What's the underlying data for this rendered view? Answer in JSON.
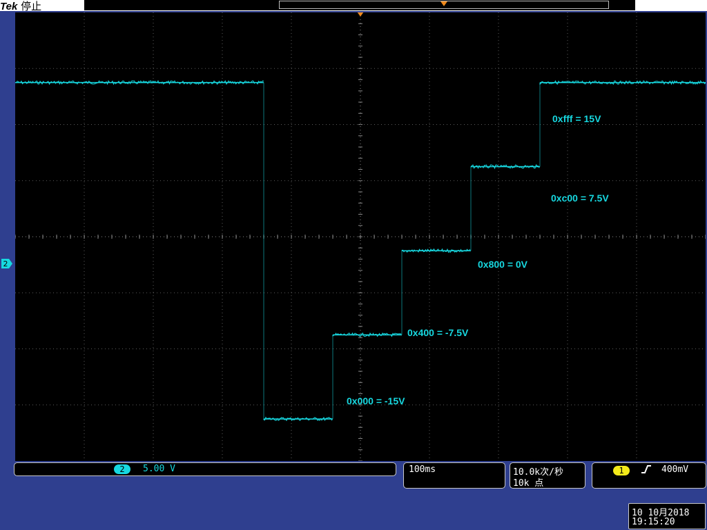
{
  "header": {
    "brand": "Tek",
    "status": "停止"
  },
  "channel": {
    "marker": "2",
    "badge": "2",
    "scale": "5.00 V"
  },
  "timebase": {
    "value": "100ms"
  },
  "acquisition": {
    "rate": "10.0k次/秒",
    "points": "10k 点"
  },
  "trigger": {
    "source": "1",
    "slope": "rising-edge-icon",
    "level": "400mV"
  },
  "datetime": {
    "date": "10 10月2018",
    "time": "19:15:20"
  },
  "colors": {
    "trace": "#17d8e0",
    "background": "#2f3f8f",
    "trigger_marker": "#f08a1c",
    "ch1": "#f3ea1a"
  },
  "waveform": {
    "x_unit": "div",
    "y_unit": "V",
    "steps": [
      {
        "t_start": 0,
        "t_end": 3.6,
        "level": 15
      },
      {
        "t_start": 3.6,
        "t_end": 4.6,
        "level": -15
      },
      {
        "t_start": 4.6,
        "t_end": 5.6,
        "level": -7.5
      },
      {
        "t_start": 5.6,
        "t_end": 6.6,
        "level": 0
      },
      {
        "t_start": 6.6,
        "t_end": 7.6,
        "level": 7.5
      },
      {
        "t_start": 7.6,
        "t_end": 10,
        "level": 15
      }
    ]
  },
  "annotations": [
    {
      "text": "0xfff = 15V"
    },
    {
      "text": "0xc00 = 7.5V"
    },
    {
      "text": "0x800 = 0V"
    },
    {
      "text": "0x400 = -7.5V"
    },
    {
      "text": "0x000 = -15V"
    }
  ]
}
